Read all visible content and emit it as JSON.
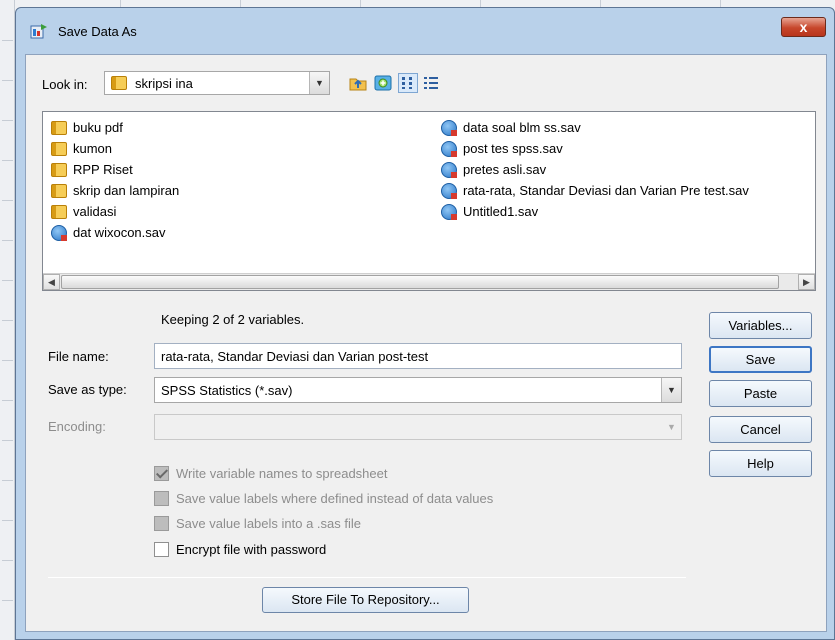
{
  "dialog": {
    "title": "Save Data As",
    "close_symbol": "x"
  },
  "look_in": {
    "label": "Look in:",
    "value": "skripsi ina",
    "icons": [
      "up-folder-icon",
      "new-folder-icon",
      "list-view-icon",
      "details-view-icon"
    ]
  },
  "files": {
    "col1": [
      {
        "name": "buku pdf",
        "type": "folder"
      },
      {
        "name": "kumon",
        "type": "folder"
      },
      {
        "name": "RPP Riset",
        "type": "folder"
      },
      {
        "name": "skrip dan lampiran",
        "type": "folder"
      },
      {
        "name": "validasi",
        "type": "folder"
      },
      {
        "name": "dat wixocon.sav",
        "type": "sav"
      }
    ],
    "col2": [
      {
        "name": "data soal blm ss.sav",
        "type": "sav"
      },
      {
        "name": "post tes spss.sav",
        "type": "sav"
      },
      {
        "name": "pretes asli.sav",
        "type": "sav"
      },
      {
        "name": "rata-rata, Standar Deviasi dan Varian Pre test.sav",
        "type": "sav"
      },
      {
        "name": "Untitled1.sav",
        "type": "sav"
      }
    ]
  },
  "form": {
    "keeping_text": "Keeping 2 of 2 variables.",
    "file_name_label": "File name:",
    "file_name_value": "rata-rata, Standar Deviasi dan Varian post-test",
    "save_as_type_label": "Save as type:",
    "save_as_type_value": "SPSS Statistics (*.sav)",
    "encoding_label": "Encoding:",
    "encoding_value": ""
  },
  "options": [
    {
      "label": "Write variable names to spreadsheet",
      "checked": true,
      "disabled": true
    },
    {
      "label": "Save value labels where defined instead of data values",
      "checked": false,
      "disabled": true
    },
    {
      "label": "Save value labels into a .sas file",
      "checked": false,
      "disabled": true
    },
    {
      "label": "Encrypt file with password",
      "checked": false,
      "disabled": false
    }
  ],
  "buttons": {
    "variables": "Variables...",
    "save": "Save",
    "paste": "Paste",
    "cancel": "Cancel",
    "help": "Help",
    "store": "Store File To Repository..."
  },
  "colors": {
    "titlebar": "#b9d1ea",
    "close_button": "#c7462b",
    "default_button_border": "#3d76c4"
  }
}
